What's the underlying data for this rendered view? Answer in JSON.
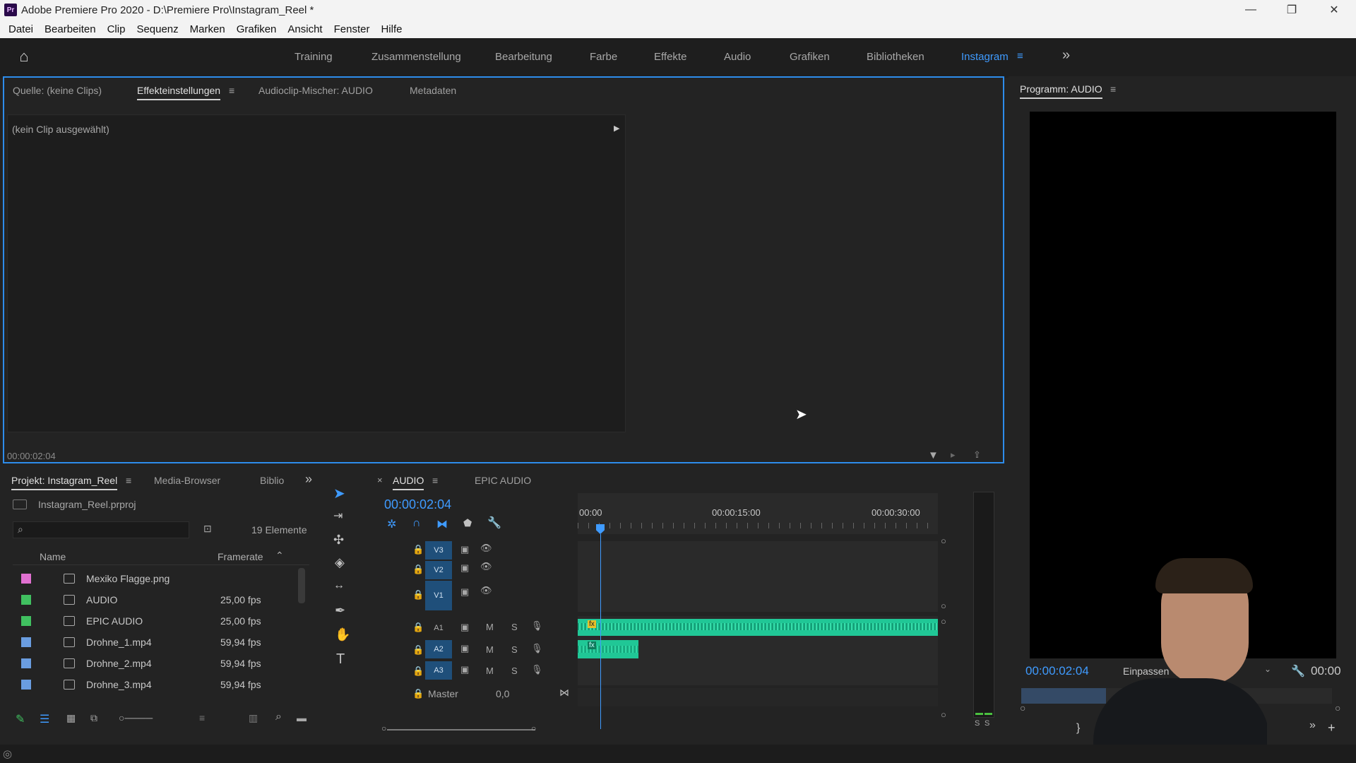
{
  "window": {
    "app_icon": "Pr",
    "title": "Adobe Premiere Pro 2020 - D:\\Premiere Pro\\Instagram_Reel *",
    "minimize": "—",
    "maximize": "❐",
    "close": "✕"
  },
  "menu": [
    "Datei",
    "Bearbeiten",
    "Clip",
    "Sequenz",
    "Marken",
    "Grafiken",
    "Ansicht",
    "Fenster",
    "Hilfe"
  ],
  "workspaces": {
    "items": [
      "Training",
      "Zusammenstellung",
      "Bearbeitung",
      "Farbe",
      "Effekte",
      "Audio",
      "Grafiken",
      "Bibliotheken",
      "Instagram"
    ],
    "active": "Instagram",
    "more": "»"
  },
  "source_panel": {
    "tabs": [
      "Quelle: (keine Clips)",
      "Effekteinstellungen",
      "Audioclip-Mischer: AUDIO",
      "Metadaten"
    ],
    "active_tab": "Effekteinstellungen",
    "no_clip_text": "(kein Clip ausgewählt)",
    "timecode": "00:00:02:04"
  },
  "program_monitor": {
    "title": "Programm: AUDIO",
    "timecode": "00:00:02:04",
    "fit": "Einpassen",
    "end_timecode": "00:00"
  },
  "project_panel": {
    "tabs": [
      "Projekt: Instagram_Reel",
      "Media-Browser",
      "Biblio"
    ],
    "active_tab": "Projekt: Instagram_Reel",
    "more": "»",
    "file": "Instagram_Reel.prproj",
    "search_placeholder": "",
    "count": "19 Elemente",
    "columns": {
      "name": "Name",
      "framerate": "Framerate"
    },
    "rows": [
      {
        "name": "Mexiko Flagge.png",
        "framerate": "",
        "color": "#e070d0",
        "icon": "image-icon"
      },
      {
        "name": "AUDIO",
        "framerate": "25,00 fps",
        "color": "#40c060",
        "icon": "sequence-icon"
      },
      {
        "name": "EPIC AUDIO",
        "framerate": "25,00 fps",
        "color": "#40c060",
        "icon": "sequence-icon"
      },
      {
        "name": "Drohne_1.mp4",
        "framerate": "59,94 fps",
        "color": "#6a9de0",
        "icon": "video-icon"
      },
      {
        "name": "Drohne_2.mp4",
        "framerate": "59,94 fps",
        "color": "#6a9de0",
        "icon": "video-icon"
      },
      {
        "name": "Drohne_3.mp4",
        "framerate": "59,94 fps",
        "color": "#6a9de0",
        "icon": "video-icon"
      }
    ]
  },
  "timeline": {
    "tabs": [
      "AUDIO",
      "EPIC AUDIO"
    ],
    "active_tab": "AUDIO",
    "close": "×",
    "timecode": "00:00:02:04",
    "ruler": [
      "00:00",
      "00:00:15:00",
      "00:00:30:00"
    ],
    "video_tracks": [
      "V3",
      "V2",
      "V1"
    ],
    "audio_tracks": [
      "A1",
      "A2",
      "A3"
    ],
    "mute": "M",
    "solo": "S",
    "master_label": "Master",
    "master_value": "0,0",
    "meter_labels": [
      "S",
      "S"
    ],
    "clip_fx_badge": "fx"
  },
  "colors": {
    "accent": "#3f9bff",
    "panel_focus": "#2d8ceb",
    "clip_audio": "#20c796",
    "track_label": "#1f4f7a"
  }
}
